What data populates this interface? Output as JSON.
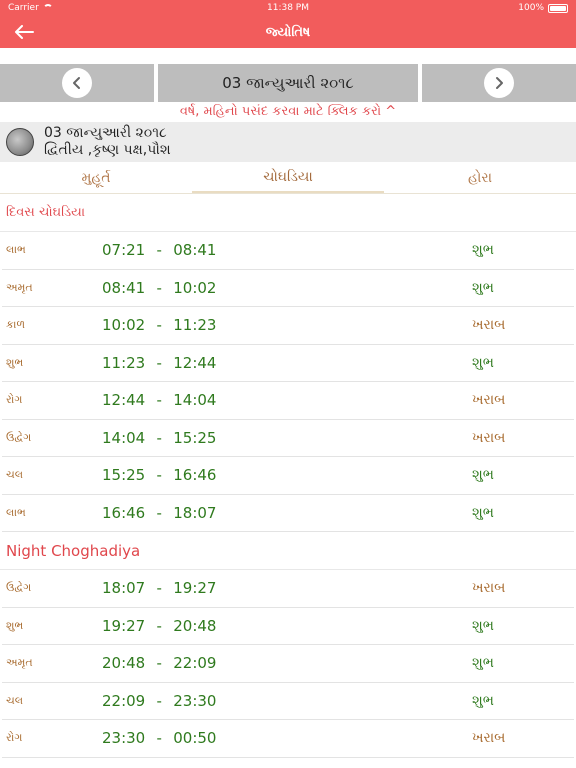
{
  "status_bar": {
    "carrier": "Carrier",
    "time": "11:38 PM",
    "battery": "100%"
  },
  "nav": {
    "title": "જ્યોતિષ"
  },
  "date_bar": {
    "current_date": "03 જાન્યુઆરી ૨૦૧૮",
    "hint": "વર્ષ, મહિનો પસંદ કરવા માટે ક્લિક કરો ^"
  },
  "moon_info": {
    "date": "03 જાન્યુઆરી ૨૦૧૮",
    "detail": "દ્વિતીય ,કૃષ્ણ પક્ષ,પૌશ"
  },
  "tabs": [
    {
      "label": "મુહૂર્ત"
    },
    {
      "label": "ચોઘડિયા"
    },
    {
      "label": "હોરા"
    }
  ],
  "day_section": {
    "title": "દિવસ ચોઘડિયા"
  },
  "day_rows": [
    {
      "name": "લાભ",
      "start": "07:21",
      "end": "08:41",
      "status": "શુભ",
      "good": true
    },
    {
      "name": "અમૃત",
      "start": "08:41",
      "end": "10:02",
      "status": "શુભ",
      "good": true
    },
    {
      "name": "કાળ",
      "start": "10:02",
      "end": "11:23",
      "status": "ખરાબ",
      "good": false
    },
    {
      "name": "શુભ",
      "start": "11:23",
      "end": "12:44",
      "status": "શુભ",
      "good": true
    },
    {
      "name": "રોગ",
      "start": "12:44",
      "end": "14:04",
      "status": "ખરાબ",
      "good": false
    },
    {
      "name": "ઉદ્વેગ",
      "start": "14:04",
      "end": "15:25",
      "status": "ખરાબ",
      "good": false
    },
    {
      "name": "ચલ",
      "start": "15:25",
      "end": "16:46",
      "status": "શુભ",
      "good": true
    },
    {
      "name": "લાભ",
      "start": "16:46",
      "end": "18:07",
      "status": "શુભ",
      "good": true
    }
  ],
  "night_section": {
    "title": "Night Choghadiya"
  },
  "night_rows": [
    {
      "name": "ઉદ્વેગ",
      "start": "18:07",
      "end": "19:27",
      "status": "ખરાબ",
      "good": false
    },
    {
      "name": "શુભ",
      "start": "19:27",
      "end": "20:48",
      "status": "શુભ",
      "good": true
    },
    {
      "name": "અમૃત",
      "start": "20:48",
      "end": "22:09",
      "status": "શુભ",
      "good": true
    },
    {
      "name": "ચલ",
      "start": "22:09",
      "end": "23:30",
      "status": "શુભ",
      "good": true
    },
    {
      "name": "રોગ",
      "start": "23:30",
      "end": "00:50",
      "status": "ખરાબ",
      "good": false
    }
  ],
  "colors": {
    "accent": "#f25c5c",
    "good": "#2f7a1e",
    "bad": "#a7692c",
    "hint": "#e0474c"
  }
}
